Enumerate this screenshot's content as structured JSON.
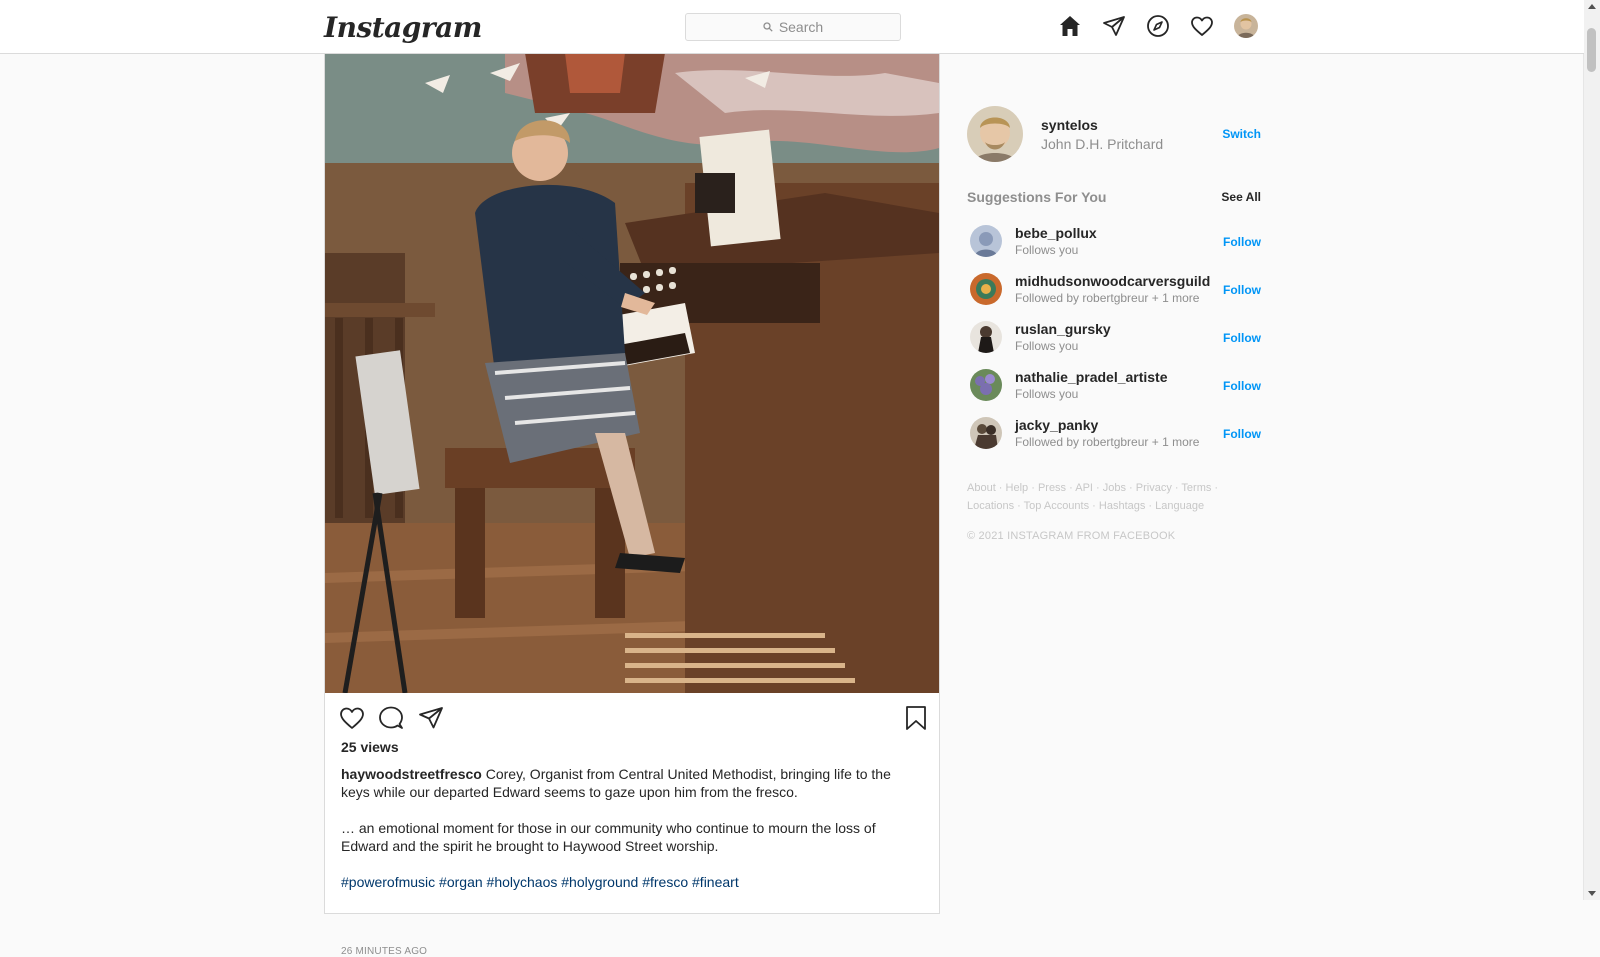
{
  "header": {
    "logo_text": "Instagram",
    "search_placeholder": "Search"
  },
  "post": {
    "views": "25 views",
    "author": "haywoodstreetfresco",
    "caption_line1": " Corey, Organist from Central United Methodist, bringing life to the keys while our departed Edward seems to gaze upon him from the fresco.",
    "caption_line2": "… an emotional moment for those in our community who continue to mourn the loss of Edward and the spirit he brought to Haywood Street worship.",
    "hashtags": [
      "#powerofmusic",
      "#organ",
      "#holychaos",
      "#holyground",
      "#fresco",
      "#fineart"
    ],
    "time_ago": "26 MINUTES AGO"
  },
  "sidebar": {
    "username": "syntelos",
    "fullname": "John D.H. Pritchard",
    "switch_label": "Switch",
    "suggestions_title": "Suggestions For You",
    "see_all_label": "See All",
    "follow_label": "Follow",
    "suggestions": [
      {
        "name": "bebe_pollux",
        "sub": "Follows you",
        "avatar_color": "#8a9ab8"
      },
      {
        "name": "midhudsonwoodcarversguild",
        "sub": "Followed by robertgbreur + 1 more",
        "avatar_color": "#c9692c"
      },
      {
        "name": "ruslan_gursky",
        "sub": "Follows you",
        "avatar_color": "#4a3a30"
      },
      {
        "name": "nathalie_pradel_artiste",
        "sub": "Follows you",
        "avatar_color": "#7b6fb0"
      },
      {
        "name": "jacky_panky",
        "sub": "Followed by robertgbreur + 1 more",
        "avatar_color": "#5a4a3a"
      }
    ],
    "footer_links": [
      "About",
      "Help",
      "Press",
      "API",
      "Jobs",
      "Privacy",
      "Terms",
      "Locations",
      "Top Accounts",
      "Hashtags",
      "Language"
    ],
    "copyright": "© 2021 INSTAGRAM FROM FACEBOOK"
  }
}
